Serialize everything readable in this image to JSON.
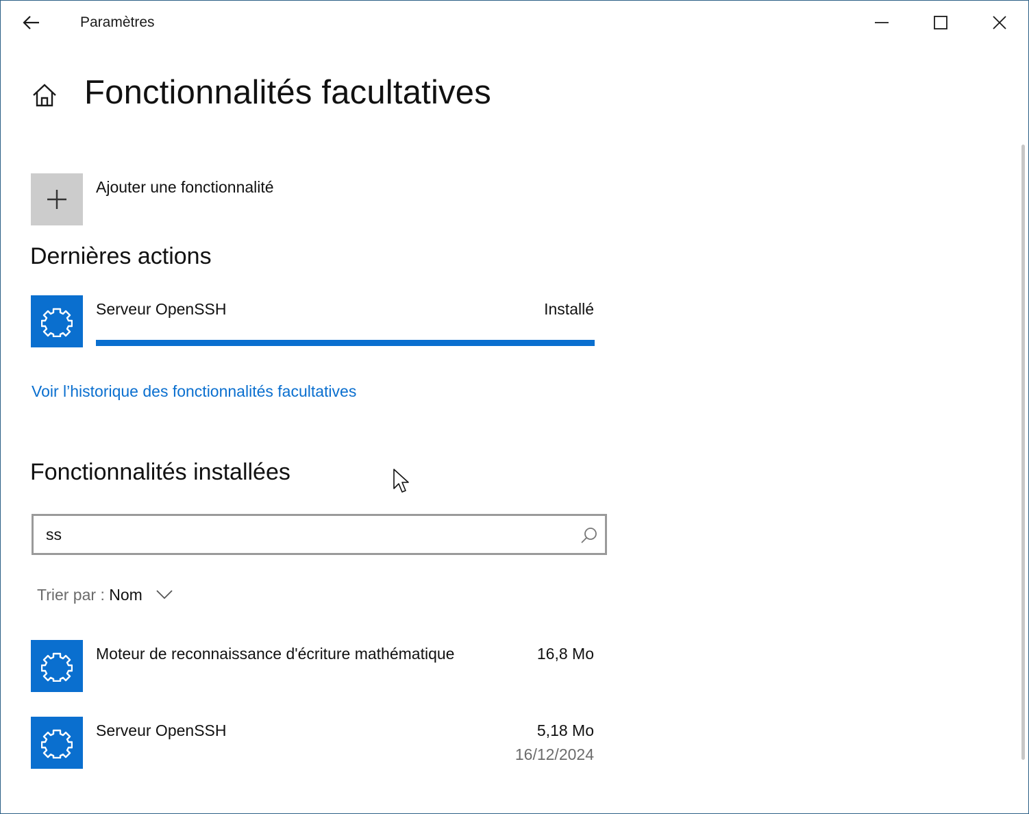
{
  "window": {
    "title": "Paramètres"
  },
  "header": {
    "page_title": "Fonctionnalités facultatives"
  },
  "add_feature": {
    "label": "Ajouter une fonctionnalité"
  },
  "recent_actions": {
    "heading": "Dernières actions",
    "items": [
      {
        "name": "Serveur OpenSSH",
        "status": "Installé",
        "progress": 1.0
      }
    ]
  },
  "history_link": "Voir l’historique des fonctionnalités facultatives",
  "installed": {
    "heading": "Fonctionnalités installées",
    "search": {
      "value": "ss",
      "placeholder": ""
    },
    "sort": {
      "label": "Trier par :",
      "value": "Nom"
    },
    "items": [
      {
        "name": "Moteur de reconnaissance d'écriture mathématique",
        "size": "16,8 Mo",
        "date": ""
      },
      {
        "name": "Serveur OpenSSH",
        "size": "5,18 Mo",
        "date": "16/12/2024"
      }
    ]
  },
  "colors": {
    "accent": "#0a6fcf",
    "tile_gray": "#cccccc",
    "secondary_text": "#6b6b6b"
  },
  "icons": {
    "back": "back-arrow-icon",
    "home": "home-icon",
    "add": "plus-icon",
    "feature": "puzzle-gear-icon",
    "search": "search-icon",
    "sort": "chevron-down-icon"
  }
}
